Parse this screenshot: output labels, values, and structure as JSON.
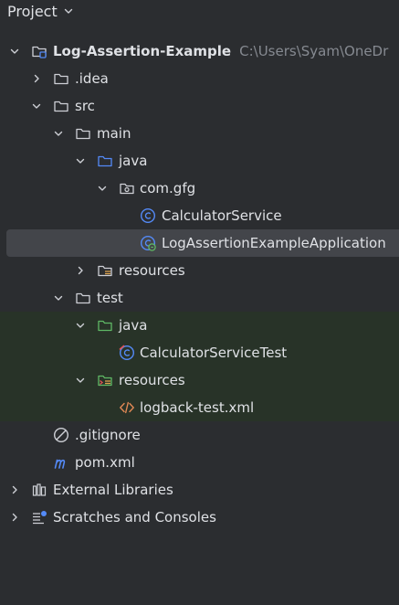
{
  "header": {
    "title": "Project"
  },
  "tree": {
    "root": {
      "label": "Log-Assertion-Example",
      "path": "C:\\Users\\Syam\\OneDr"
    },
    "idea": {
      "label": ".idea"
    },
    "src": {
      "label": "src"
    },
    "main": {
      "label": "main"
    },
    "main_java": {
      "label": "java"
    },
    "package": {
      "label": "com.gfg"
    },
    "calc_service": {
      "label": "CalculatorService"
    },
    "app_class": {
      "label": "LogAssertionExampleApplication"
    },
    "main_resources": {
      "label": "resources"
    },
    "test": {
      "label": "test"
    },
    "test_java": {
      "label": "java"
    },
    "calc_test": {
      "label": "CalculatorServiceTest"
    },
    "test_resources": {
      "label": "resources"
    },
    "logback": {
      "label": "logback-test.xml"
    },
    "gitignore": {
      "label": ".gitignore"
    },
    "pom": {
      "label": "pom.xml"
    },
    "ext_libs": {
      "label": "External Libraries"
    },
    "scratches": {
      "label": "Scratches and Consoles"
    }
  },
  "colors": {
    "background": "#2b2d30",
    "selection": "#43454a",
    "test_highlight": "#283328",
    "source_folder": "#548af7",
    "test_folder": "#5fb865",
    "class_icon": "#548af7",
    "xml_icon": "#e08855"
  },
  "icons": {
    "chevron_down": "chevron-down-icon",
    "chevron_right": "chevron-right-icon",
    "folder": "folder-icon",
    "module": "module-icon",
    "package": "package-icon",
    "class": "class-icon",
    "spring_class": "spring-class-icon",
    "test_class": "test-class-icon",
    "resources": "resources-folder-icon",
    "xml": "xml-file-icon",
    "ignore": "gitignore-icon",
    "maven": "maven-icon",
    "library": "library-icon",
    "scratches": "scratches-icon"
  }
}
